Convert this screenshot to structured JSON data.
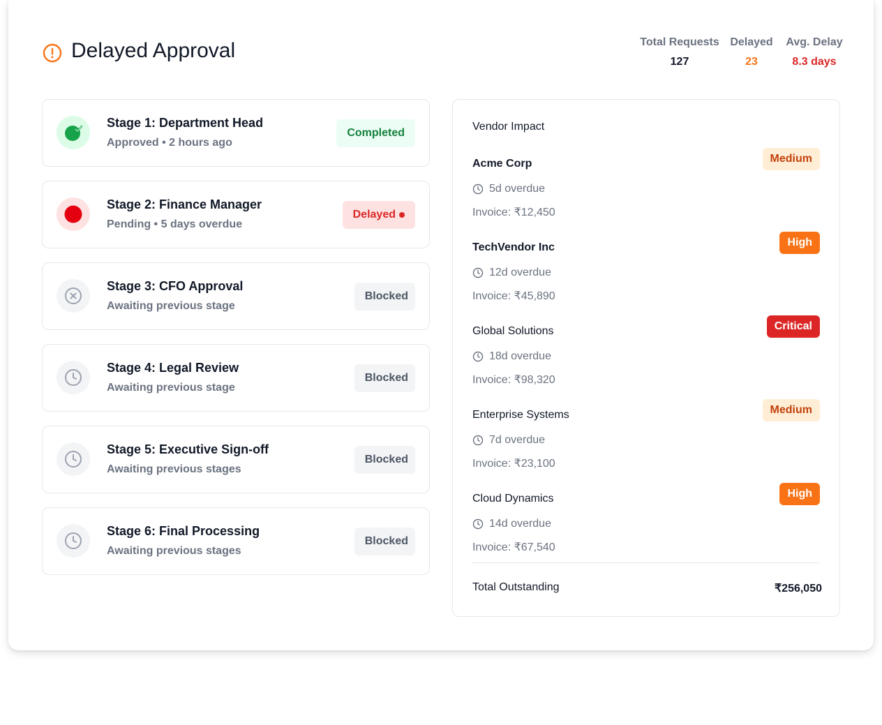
{
  "header": {
    "title": "Delayed Approval",
    "icon": "alert-circle-icon",
    "stats": {
      "total_label": "Total Requests",
      "total_value": "127",
      "delayed_label": "Delayed",
      "delayed_value": "23",
      "avg_label": "Avg. Delay",
      "avg_value": "8.3 days"
    }
  },
  "stages": [
    {
      "title": "Stage 1: Department Head",
      "subtitle": "Approved • 2 hours ago",
      "status": "Completed",
      "icon": "check-circle-icon"
    },
    {
      "title": "Stage 2: Finance Manager",
      "subtitle": "Pending • 5 days overdue",
      "status": "Delayed",
      "icon": "red-dot-icon"
    },
    {
      "title": "Stage 3: CFO Approval",
      "subtitle": "Awaiting previous stage",
      "status": "Blocked",
      "icon": "x-circle-icon"
    },
    {
      "title": "Stage 4: Legal Review",
      "subtitle": "Awaiting previous stage",
      "status": "Blocked",
      "icon": "clock-icon"
    },
    {
      "title": "Stage 5: Executive Sign-off",
      "subtitle": "Awaiting previous stages",
      "status": "Blocked",
      "icon": "clock-icon"
    },
    {
      "title": "Stage 6: Final Processing",
      "subtitle": "Awaiting previous stages",
      "status": "Blocked",
      "icon": "clock-icon"
    }
  ],
  "vendor_impact": {
    "title": "Vendor Impact",
    "vendors": [
      {
        "name": "Acme Corp",
        "severity": "Medium",
        "overdue": "5d overdue",
        "invoice": "Invoice: ₹12,450"
      },
      {
        "name": "TechVendor Inc",
        "severity": "High",
        "overdue": "12d overdue",
        "invoice": "Invoice: ₹45,890"
      },
      {
        "name": "Global Solutions",
        "severity": "Critical",
        "overdue": "18d overdue",
        "invoice": "Invoice: ₹98,320"
      },
      {
        "name": "Enterprise Systems",
        "severity": "Medium",
        "overdue": "7d overdue",
        "invoice": "Invoice: ₹23,100"
      },
      {
        "name": "Cloud Dynamics",
        "severity": "High",
        "overdue": "14d overdue",
        "invoice": "Invoice: ₹67,540"
      }
    ],
    "total_label": "Total Outstanding",
    "total_value": "₹256,050"
  },
  "colors": {
    "accent_orange": "#f97316",
    "danger_red": "#dc2626",
    "success_green": "#16a34a",
    "muted_gray": "#6b7280"
  }
}
